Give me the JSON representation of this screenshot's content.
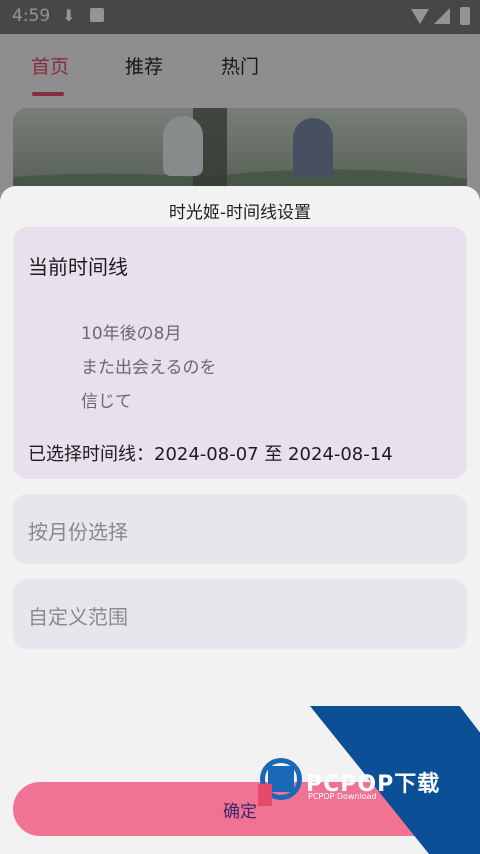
{
  "status_bar": {
    "time": "4:59"
  },
  "tabs": [
    {
      "label": "首页",
      "active": true
    },
    {
      "label": "推荐",
      "active": false
    },
    {
      "label": "热门",
      "active": false
    }
  ],
  "sheet": {
    "title": "时光姬-时间线设置",
    "current": {
      "heading": "当前时间线",
      "poem_lines": [
        "10年後の8月",
        "また出会えるのを",
        "信じて"
      ],
      "selected": "已选择时间线：2024-08-07 至 2024-08-14"
    },
    "options": [
      {
        "label": "按月份选择"
      },
      {
        "label": "自定义范围"
      }
    ],
    "confirm_label": "确定"
  },
  "watermark": {
    "brand": "PCPOP下载",
    "sub": "PCPOP Download"
  },
  "colors": {
    "accent": "#e4506f",
    "confirm_bg": "#f07394",
    "card_bg": "#e8e0ec"
  }
}
